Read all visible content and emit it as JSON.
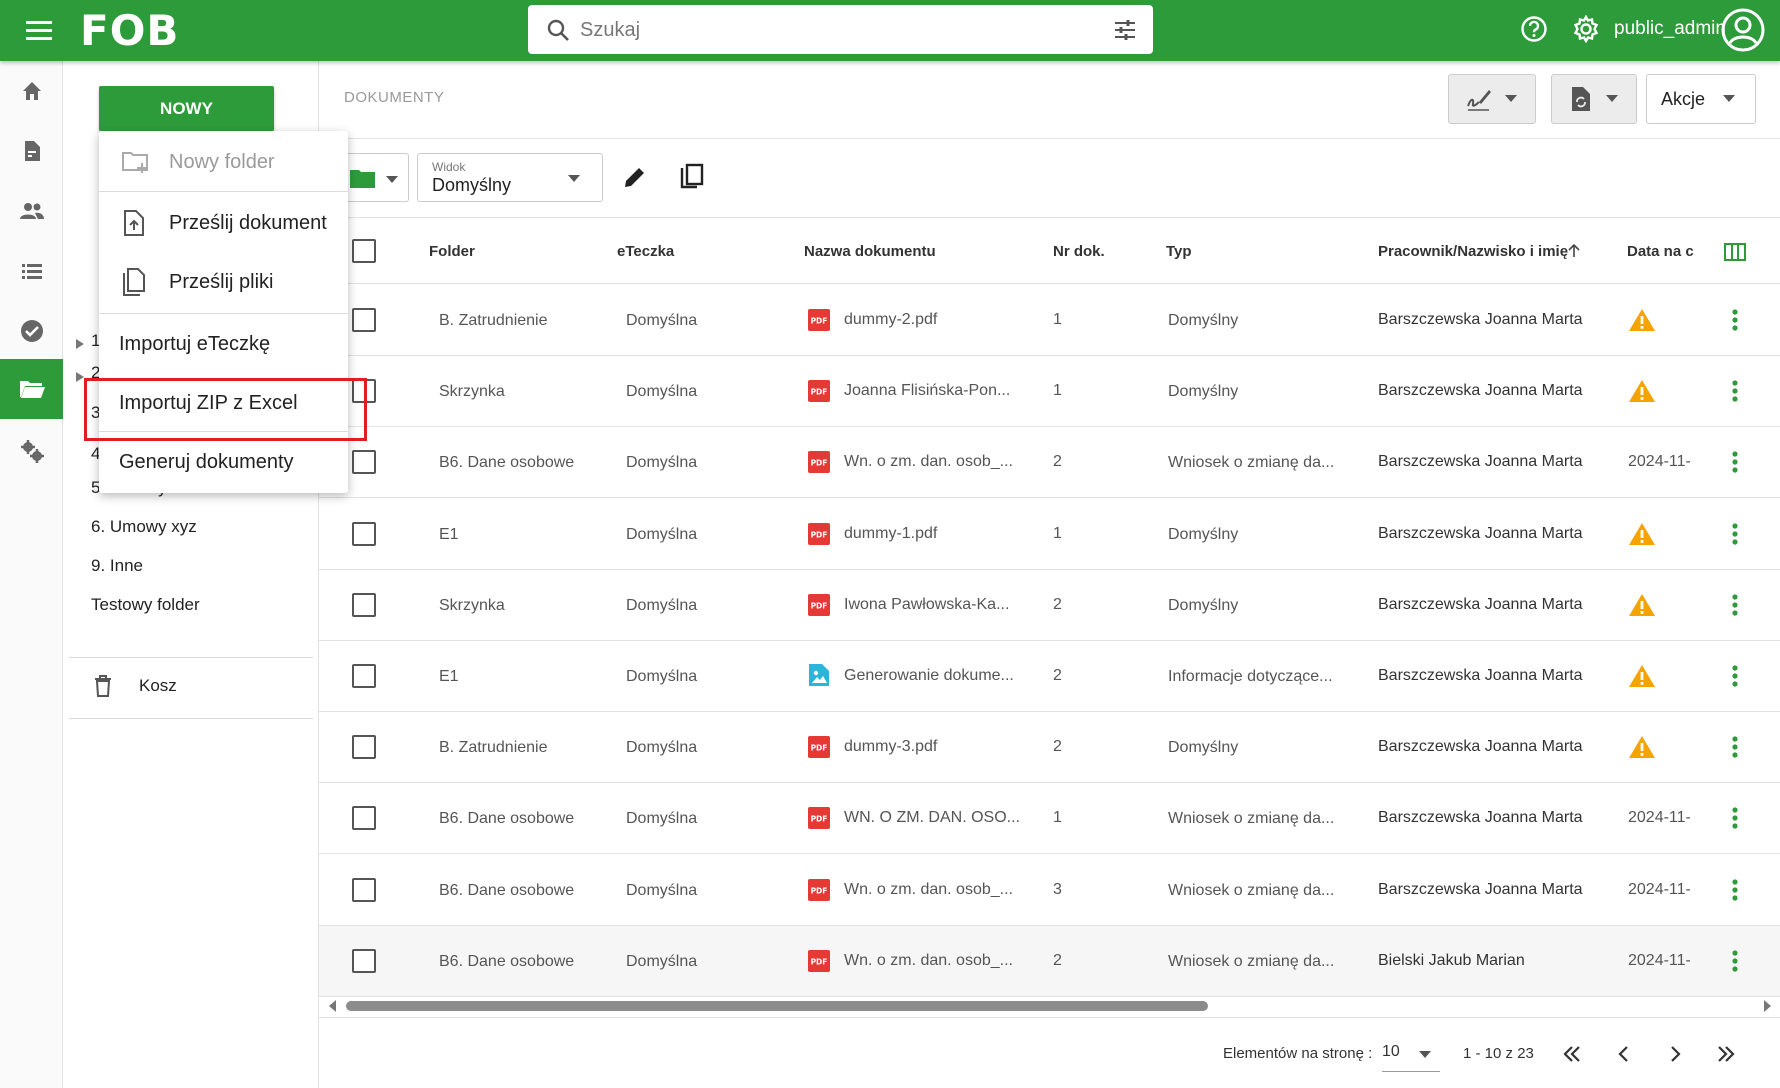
{
  "app": {
    "logo": "FOB",
    "username": "public_admin"
  },
  "search": {
    "placeholder": "Szukaj"
  },
  "sidebar": {
    "new_button": "NOWY"
  },
  "menu": {
    "items": [
      {
        "label": "Nowy folder",
        "icon": "create-folder-icon",
        "disabled": true
      },
      {
        "label": "Prześlij dokument",
        "icon": "upload-file-icon"
      },
      {
        "label": "Prześlij pliki",
        "icon": "files-icon"
      },
      {
        "label": "Importuj eTeczkę"
      },
      {
        "label": "Importuj ZIP z Excel"
      },
      {
        "label": "Generuj dokumenty"
      }
    ]
  },
  "folders": {
    "partial": [
      "1",
      "2",
      "3",
      "4"
    ],
    "items": [
      "5. Umowy zlecenia",
      "6. Umowy xyz",
      "9. Inne",
      "Testowy folder"
    ],
    "trash": "Kosz"
  },
  "main": {
    "breadcrumb": "DOKUMENTY",
    "actions_label": "Akcje",
    "view_label": "Widok",
    "view_value": "Domyślny"
  },
  "table": {
    "headers": {
      "folder": "Folder",
      "eteczka": "eTeczka",
      "nazwa": "Nazwa dokumentu",
      "nr": "Nr dok.",
      "typ": "Typ",
      "pracownik": "Pracownik/Nazwisko i imię",
      "data": "Data na c"
    },
    "rows": [
      {
        "folder": "B. Zatrudnienie",
        "eteczka": "Domyślna",
        "icon": "pdf",
        "nazwa": "dummy-2.pdf",
        "nr": "1",
        "typ": "Domyślny",
        "pracownik": "Barszczewska Joanna Marta",
        "data": "",
        "warn": true
      },
      {
        "folder": "Skrzynka",
        "eteczka": "Domyślna",
        "icon": "pdf",
        "nazwa": "Joanna Flisińska-Pon...",
        "nr": "1",
        "typ": "Domyślny",
        "pracownik": "Barszczewska Joanna Marta",
        "data": "",
        "warn": true
      },
      {
        "folder": "B6. Dane osobowe",
        "eteczka": "Domyślna",
        "icon": "pdf",
        "nazwa": "Wn. o zm. dan. osob_...",
        "nr": "2",
        "typ": "Wniosek o zmianę da...",
        "pracownik": "Barszczewska Joanna Marta",
        "data": "2024-11-",
        "warn": false
      },
      {
        "folder": "E1",
        "eteczka": "Domyślna",
        "icon": "pdf",
        "nazwa": "dummy-1.pdf",
        "nr": "1",
        "typ": "Domyślny",
        "pracownik": "Barszczewska Joanna Marta",
        "data": "",
        "warn": true
      },
      {
        "folder": "Skrzynka",
        "eteczka": "Domyślna",
        "icon": "pdf",
        "nazwa": "Iwona Pawłowska-Ka...",
        "nr": "2",
        "typ": "Domyślny",
        "pracownik": "Barszczewska Joanna Marta",
        "data": "",
        "warn": true
      },
      {
        "folder": "E1",
        "eteczka": "Domyślna",
        "icon": "image",
        "nazwa": "Generowanie dokume...",
        "nr": "2",
        "typ": "Informacje dotyczące...",
        "pracownik": "Barszczewska Joanna Marta",
        "data": "",
        "warn": true
      },
      {
        "folder": "B. Zatrudnienie",
        "eteczka": "Domyślna",
        "icon": "pdf",
        "nazwa": "dummy-3.pdf",
        "nr": "2",
        "typ": "Domyślny",
        "pracownik": "Barszczewska Joanna Marta",
        "data": "",
        "warn": true
      },
      {
        "folder": "B6. Dane osobowe",
        "eteczka": "Domyślna",
        "icon": "pdf",
        "nazwa": "WN. O ZM. DAN. OSO...",
        "nr": "1",
        "typ": "Wniosek o zmianę da...",
        "pracownik": "Barszczewska Joanna Marta",
        "data": "2024-11-",
        "warn": false
      },
      {
        "folder": "B6. Dane osobowe",
        "eteczka": "Domyślna",
        "icon": "pdf",
        "nazwa": "Wn. o zm. dan. osob_...",
        "nr": "3",
        "typ": "Wniosek o zmianę da...",
        "pracownik": "Barszczewska Joanna Marta",
        "data": "2024-11-",
        "warn": false
      },
      {
        "folder": "B6. Dane osobowe",
        "eteczka": "Domyślna",
        "icon": "pdf",
        "nazwa": "Wn. o zm. dan. osob_...",
        "nr": "2",
        "typ": "Wniosek o zmianę da...",
        "pracownik": "Bielski Jakub Marian",
        "data": "2024-11-",
        "warn": false
      }
    ]
  },
  "pager": {
    "label": "Elementów na stronę :",
    "size": "10",
    "range": "1 - 10 z 23"
  },
  "colors": {
    "brand": "#2e9b3a",
    "highlight": "#e31b23",
    "pdf": "#e53935",
    "warn": "#f5a300"
  }
}
